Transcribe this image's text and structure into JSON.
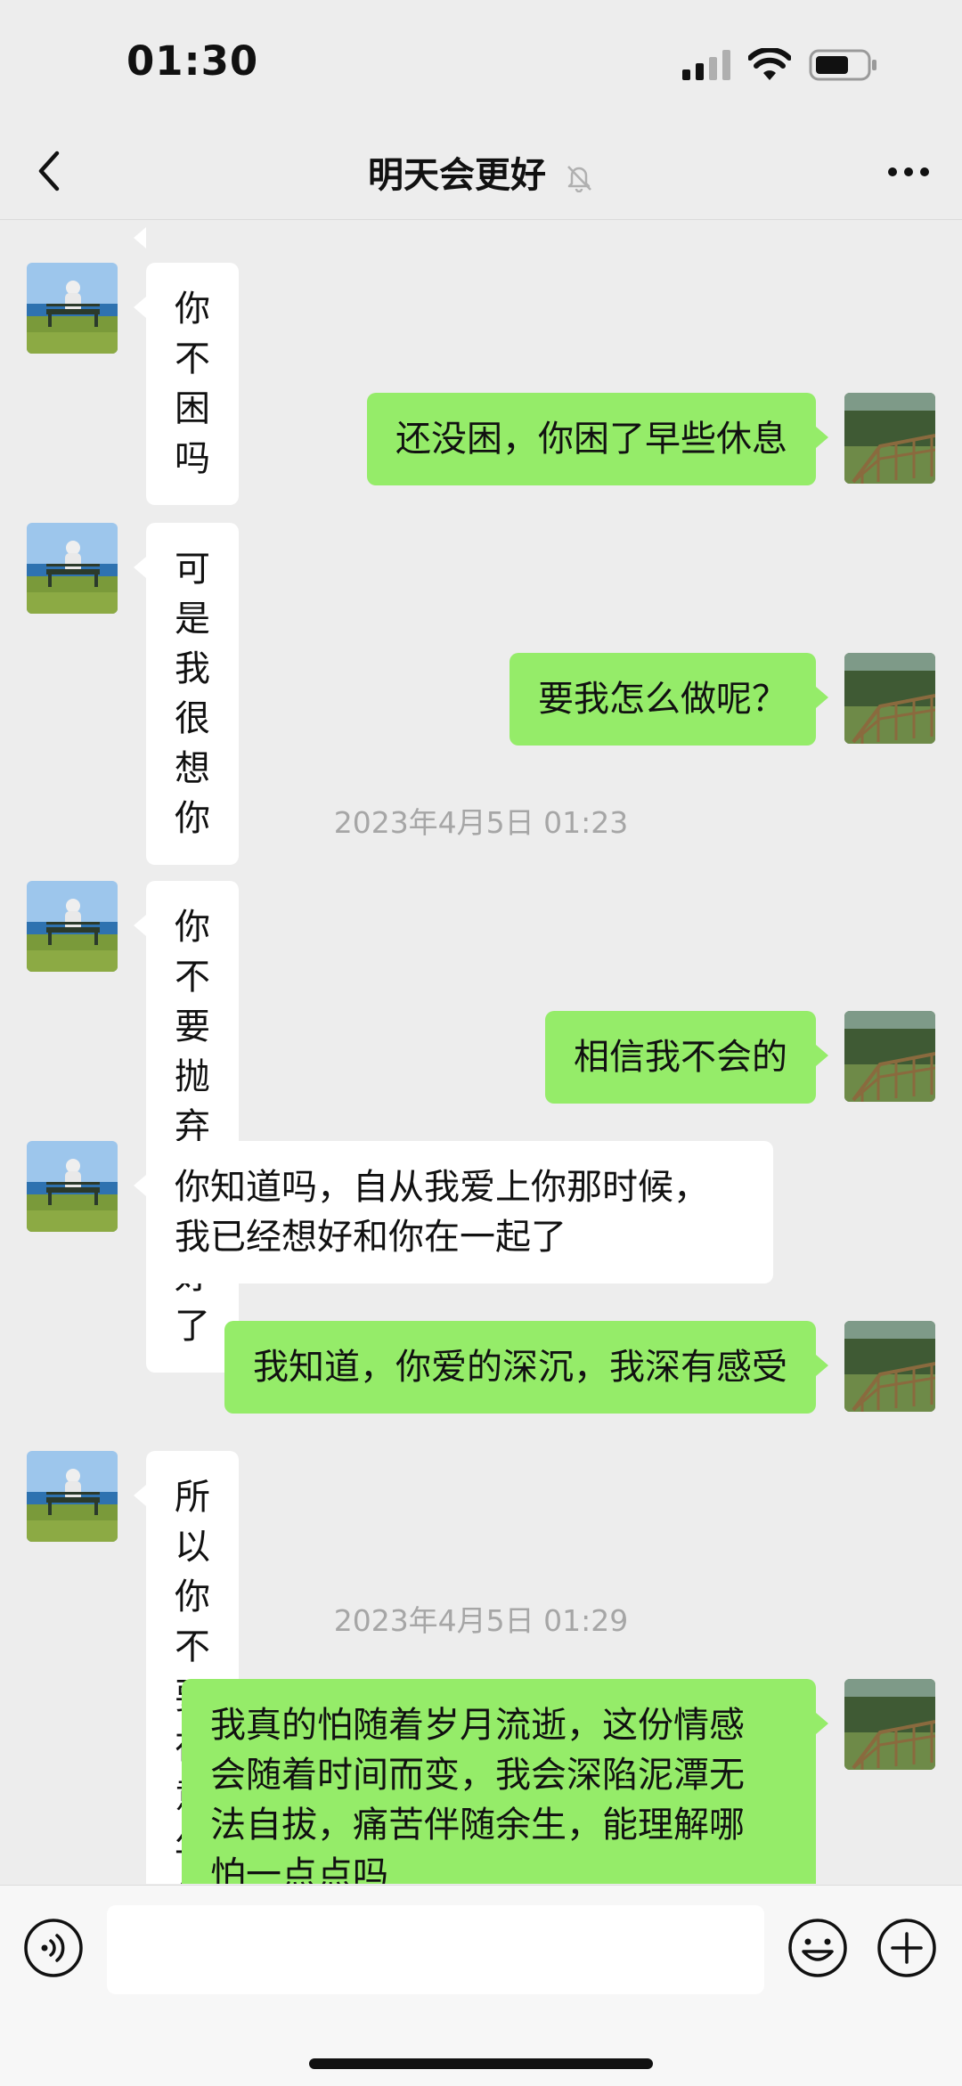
{
  "status_bar": {
    "time": "01:30",
    "icons": [
      "signal-icon",
      "wifi-icon",
      "battery-icon"
    ]
  },
  "header": {
    "title": "明天会更好",
    "icons": [
      "back-icon",
      "mute-bell-icon",
      "more-icon"
    ]
  },
  "messages": [
    {
      "side": "in",
      "text": "你不困吗"
    },
    {
      "side": "out",
      "text": "还没困，你困了早些休息"
    },
    {
      "side": "in",
      "text": "可是我很想你"
    },
    {
      "side": "out",
      "text": "要我怎么做呢？"
    },
    {
      "type": "time",
      "text": "2023年4月5日 01:23"
    },
    {
      "side": "in",
      "text": "你不要抛弃我就好了"
    },
    {
      "side": "out",
      "text": "相信我不会的"
    },
    {
      "side": "in",
      "text": "你知道吗，自从我爱上你那时候，\n我已经想好和你在一起了"
    },
    {
      "side": "out",
      "text": "我知道，你爱的深沉，我深有感受"
    },
    {
      "side": "in",
      "text": "所以你不要在意年纪好吗"
    },
    {
      "type": "time",
      "text": "2023年4月5日 01:29"
    },
    {
      "side": "out",
      "text": "我真的怕随着岁月流逝，这份情感\n会随着时间而变，我会深陷泥潭无\n法自拔，痛苦伴随余生，能理解哪\n怕一点点吗"
    }
  ],
  "input_bar": {
    "placeholder": "",
    "icons": [
      "voice-icon",
      "emoji-icon",
      "plus-icon"
    ]
  },
  "colors": {
    "background": "#EDEDED",
    "outgoing_bubble": "#95EC69",
    "incoming_bubble": "#FFFFFF",
    "timestamp": "#A6A6A6"
  }
}
